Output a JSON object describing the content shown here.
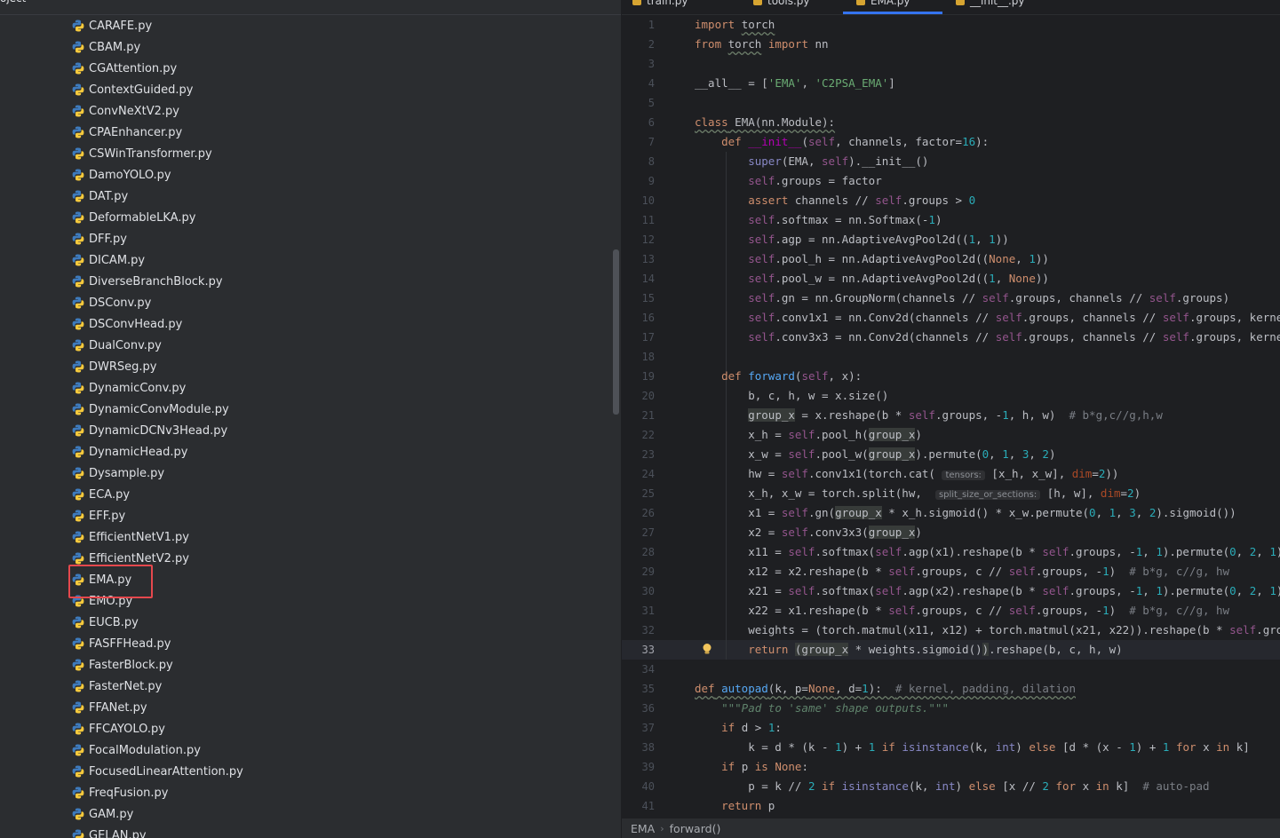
{
  "project": {
    "title": "oject",
    "files": [
      "CARAFE.py",
      "CBAM.py",
      "CGAttention.py",
      "ContextGuided.py",
      "ConvNeXtV2.py",
      "CPAEnhancer.py",
      "CSWinTransformer.py",
      "DamoYOLO.py",
      "DAT.py",
      "DeformableLKA.py",
      "DFF.py",
      "DICAM.py",
      "DiverseBranchBlock.py",
      "DSConv.py",
      "DSConvHead.py",
      "DualConv.py",
      "DWRSeg.py",
      "DynamicConv.py",
      "DynamicConvModule.py",
      "DynamicDCNv3Head.py",
      "DynamicHead.py",
      "Dysample.py",
      "ECA.py",
      "EFF.py",
      "EfficientNetV1.py",
      "EfficientNetV2.py",
      "EMA.py",
      "EMO.py",
      "EUCB.py",
      "FASFFHead.py",
      "FasterBlock.py",
      "FasterNet.py",
      "FFANet.py",
      "FFCAYOLO.py",
      "FocalModulation.py",
      "FocusedLinearAttention.py",
      "FreqFusion.py",
      "GAM.py",
      "GELAN.py"
    ],
    "highlighted_file": "EMA.py"
  },
  "editor": {
    "tabs": [
      "train.py",
      "tools.py",
      "EMA.py",
      "__init__.py"
    ],
    "active_tab": "EMA.py",
    "current_line": 33,
    "line_numbers": [
      "1",
      "2",
      "3",
      "4",
      "5",
      "6",
      "7",
      "8",
      "9",
      "10",
      "11",
      "12",
      "13",
      "14",
      "15",
      "16",
      "17",
      "18",
      "19",
      "20",
      "21",
      "22",
      "23",
      "24",
      "25",
      "26",
      "27",
      "28",
      "29",
      "30",
      "31",
      "32",
      "33",
      "34",
      "35",
      "36",
      "37",
      "38",
      "39",
      "40",
      "41"
    ],
    "inlay_hints": {
      "tensors": "tensors:",
      "split": "split_size_or_sections:"
    }
  },
  "status": {
    "crumb_class": "EMA",
    "crumb_method": "forward()"
  },
  "colors": {
    "accent": "#3574f0",
    "highlight_box": "#e5484d",
    "keyword": "#cf8e6d",
    "self": "#94558d",
    "number": "#2aacb8",
    "string": "#6aab73",
    "function": "#56a8f5"
  }
}
